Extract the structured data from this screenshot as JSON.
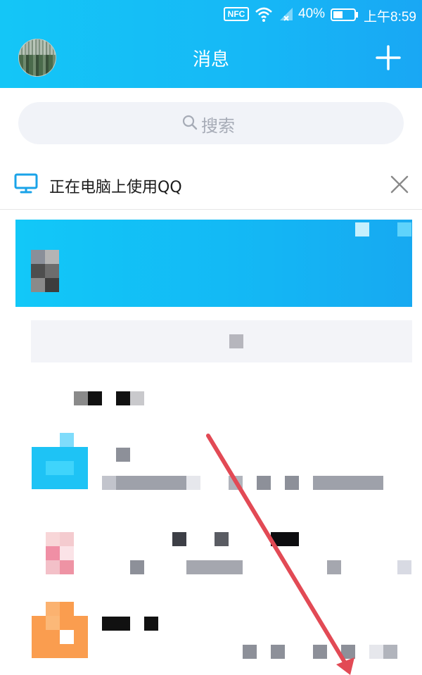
{
  "status_bar": {
    "nfc": "NFC",
    "battery_percent": "40%",
    "time": "上午8:59"
  },
  "header": {
    "title": "消息",
    "add_icon": "plus-icon",
    "avatar_icon": "avatar-image"
  },
  "search": {
    "placeholder": "搜索",
    "icon": "search-icon"
  },
  "pc_notice": {
    "label": "正在电脑上使用QQ",
    "icon": "monitor-icon",
    "close_icon": "close-icon"
  },
  "colors": {
    "header_start": "#14c6f7",
    "header_end": "#19a7f4",
    "annotation_arrow": "#e24a55"
  }
}
